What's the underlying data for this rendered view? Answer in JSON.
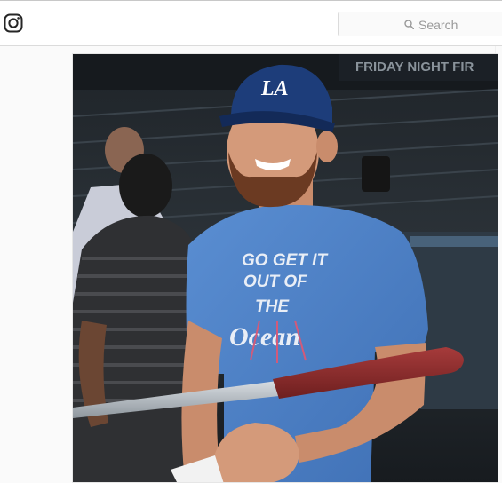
{
  "header": {
    "logo_icon": "instagram-camera-icon",
    "search": {
      "placeholder": "Search",
      "icon": "search-icon"
    }
  },
  "post": {
    "photo": {
      "subject": "baseball-player-portrait",
      "background_sign_text": "FRIDAY NIGHT FIR",
      "cap_logo": "LA",
      "shirt_text": [
        "GO GET IT",
        "OUT OF",
        "THE",
        "Ocean"
      ],
      "colors": {
        "shirt": "#4a7fc4",
        "cap": "#1d3d7a",
        "bat": "#8b2a2a",
        "skin": "#d49a7a"
      }
    }
  },
  "colors": {
    "border": "#dbdbdb",
    "page_bg": "#fafafa",
    "text_muted": "#999999"
  }
}
